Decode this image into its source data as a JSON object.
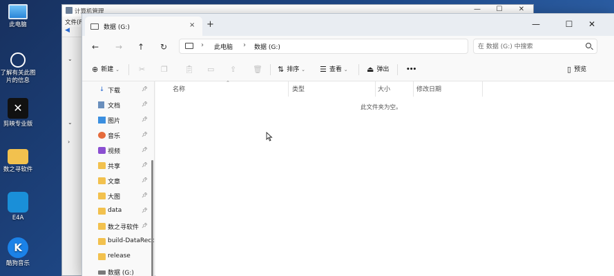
{
  "desktop": {
    "icons": [
      {
        "label": "此电脑",
        "icon": "this-pc-icon"
      },
      {
        "label": "了解有关此图片的信息",
        "icon": "info-icon"
      },
      {
        "label": "剪映专业版",
        "icon": "capcut-icon"
      },
      {
        "label": "数之寻软件",
        "icon": "folder-icon"
      },
      {
        "label": "E4A",
        "icon": "e4a-icon"
      },
      {
        "label": "酷狗音乐",
        "icon": "kugou-icon"
      }
    ]
  },
  "background_window": {
    "title": "计算机管理",
    "menu_partial": "文件(F"
  },
  "explorer": {
    "tab": {
      "label": "数据 (G:)",
      "close": "×"
    },
    "new_tab": "+",
    "window_controls": {
      "minimize": "—",
      "maximize": "☐",
      "close": "✕"
    },
    "breadcrumb": [
      "此电脑",
      "数据 (G:)"
    ],
    "search_placeholder": "在 数据 (G:) 中搜索",
    "commands": {
      "new": "新建",
      "sort": "排序",
      "view": "查看",
      "eject": "弹出",
      "more": "•••",
      "preview": "预览"
    },
    "nav_items": [
      {
        "label": "下载",
        "icon": "download-icon",
        "pinned": true
      },
      {
        "label": "文档",
        "icon": "document-icon",
        "pinned": true
      },
      {
        "label": "图片",
        "icon": "picture-icon",
        "pinned": true
      },
      {
        "label": "音乐",
        "icon": "music-icon",
        "pinned": true
      },
      {
        "label": "视频",
        "icon": "video-icon",
        "pinned": true
      },
      {
        "label": "共享",
        "icon": "folder-icon",
        "pinned": true
      },
      {
        "label": "文章",
        "icon": "folder-icon",
        "pinned": true
      },
      {
        "label": "大图",
        "icon": "folder-icon",
        "pinned": true
      },
      {
        "label": "data",
        "icon": "folder-icon",
        "pinned": true
      },
      {
        "label": "数之寻软件",
        "icon": "folder-icon",
        "pinned": true
      },
      {
        "label": "build-DataReco",
        "icon": "folder-icon",
        "pinned": false
      },
      {
        "label": "release",
        "icon": "folder-icon",
        "pinned": false
      },
      {
        "label": "数据 (G:)",
        "icon": "drive-icon",
        "pinned": false
      }
    ],
    "columns": [
      "名称",
      "类型",
      "大小",
      "修改日期"
    ],
    "empty_message": "此文件夹为空。"
  },
  "colors": {
    "folder": "#f2c14e",
    "window_bg": "#f9f9f9",
    "desktop_bg": "#1f4a8a"
  }
}
